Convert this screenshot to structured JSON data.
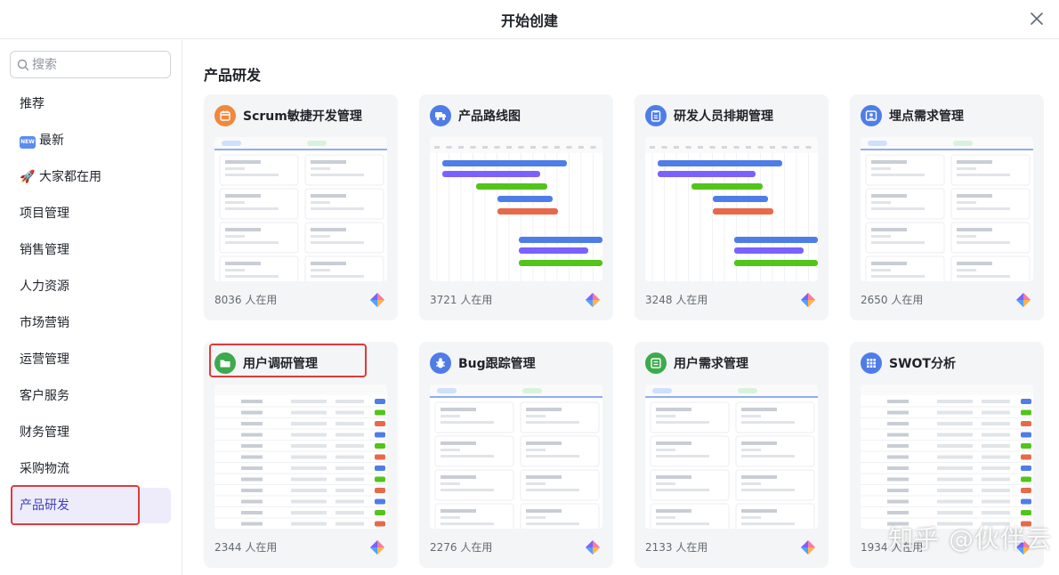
{
  "dialog": {
    "title": "开始创建"
  },
  "search": {
    "placeholder": "搜索"
  },
  "sidebar": {
    "items": [
      {
        "label": "推荐",
        "active": false
      },
      {
        "label": "最新",
        "active": false,
        "badge": "NEW"
      },
      {
        "label": "大家都在用",
        "active": false,
        "icon": "🚀"
      },
      {
        "label": "项目管理",
        "active": false
      },
      {
        "label": "销售管理",
        "active": false
      },
      {
        "label": "人力资源",
        "active": false
      },
      {
        "label": "市场营销",
        "active": false
      },
      {
        "label": "运营管理",
        "active": false
      },
      {
        "label": "客户服务",
        "active": false
      },
      {
        "label": "财务管理",
        "active": false
      },
      {
        "label": "采购物流",
        "active": false
      },
      {
        "label": "产品研发",
        "active": true
      }
    ]
  },
  "main": {
    "section_title": "产品研发",
    "cards": [
      {
        "title": "Scrum敏捷开发管理",
        "usage": "8036 人在用",
        "icon": "calendar-icon",
        "icon_color": "#f0883e",
        "preview": "kanban"
      },
      {
        "title": "产品路线图",
        "usage": "3721 人在用",
        "icon": "truck-icon",
        "icon_color": "#4f7de8",
        "preview": "gantt"
      },
      {
        "title": "研发人员排期管理",
        "usage": "3248 人在用",
        "icon": "clipboard-icon",
        "icon_color": "#4f7de8",
        "preview": "gantt"
      },
      {
        "title": "埋点需求管理",
        "usage": "2650 人在用",
        "icon": "image-icon",
        "icon_color": "#4f7de8",
        "preview": "kanban"
      },
      {
        "title": "用户调研管理",
        "usage": "2344 人在用",
        "icon": "folder-icon",
        "icon_color": "#3daa4d",
        "preview": "table"
      },
      {
        "title": "Bug跟踪管理",
        "usage": "2276 人在用",
        "icon": "bug-icon",
        "icon_color": "#4f7de8",
        "preview": "kanban"
      },
      {
        "title": "用户需求管理",
        "usage": "2133 人在用",
        "icon": "list-icon",
        "icon_color": "#3daa4d",
        "preview": "kanban"
      },
      {
        "title": "SWOT分析",
        "usage": "1934 人在用",
        "icon": "grid-icon",
        "icon_color": "#4f7de8",
        "preview": "table"
      }
    ]
  },
  "watermark": "知乎 @伙伴云"
}
